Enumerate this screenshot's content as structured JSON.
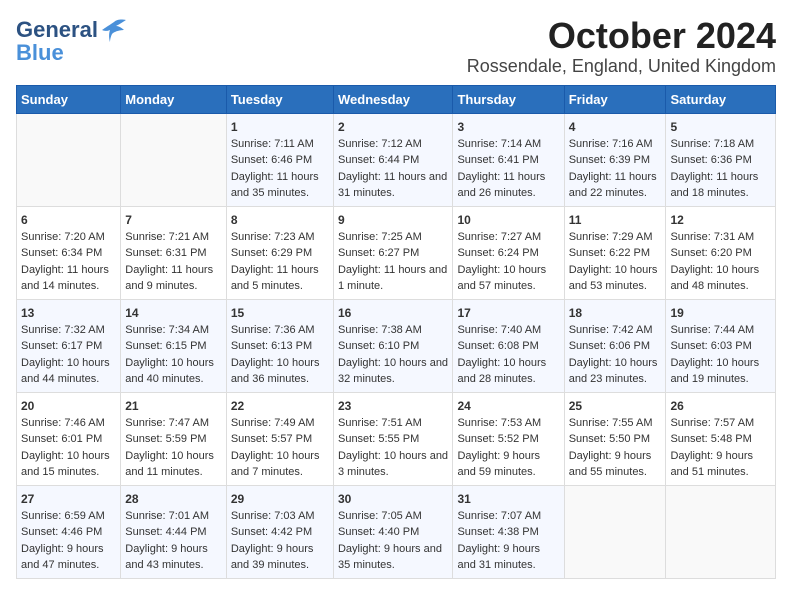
{
  "logo": {
    "line1": "General",
    "line2": "Blue"
  },
  "title": "October 2024",
  "location": "Rossendale, England, United Kingdom",
  "headers": [
    "Sunday",
    "Monday",
    "Tuesday",
    "Wednesday",
    "Thursday",
    "Friday",
    "Saturday"
  ],
  "weeks": [
    [
      {
        "day": "",
        "sunrise": "",
        "sunset": "",
        "daylight": ""
      },
      {
        "day": "",
        "sunrise": "",
        "sunset": "",
        "daylight": ""
      },
      {
        "day": "1",
        "sunrise": "Sunrise: 7:11 AM",
        "sunset": "Sunset: 6:46 PM",
        "daylight": "Daylight: 11 hours and 35 minutes."
      },
      {
        "day": "2",
        "sunrise": "Sunrise: 7:12 AM",
        "sunset": "Sunset: 6:44 PM",
        "daylight": "Daylight: 11 hours and 31 minutes."
      },
      {
        "day": "3",
        "sunrise": "Sunrise: 7:14 AM",
        "sunset": "Sunset: 6:41 PM",
        "daylight": "Daylight: 11 hours and 26 minutes."
      },
      {
        "day": "4",
        "sunrise": "Sunrise: 7:16 AM",
        "sunset": "Sunset: 6:39 PM",
        "daylight": "Daylight: 11 hours and 22 minutes."
      },
      {
        "day": "5",
        "sunrise": "Sunrise: 7:18 AM",
        "sunset": "Sunset: 6:36 PM",
        "daylight": "Daylight: 11 hours and 18 minutes."
      }
    ],
    [
      {
        "day": "6",
        "sunrise": "Sunrise: 7:20 AM",
        "sunset": "Sunset: 6:34 PM",
        "daylight": "Daylight: 11 hours and 14 minutes."
      },
      {
        "day": "7",
        "sunrise": "Sunrise: 7:21 AM",
        "sunset": "Sunset: 6:31 PM",
        "daylight": "Daylight: 11 hours and 9 minutes."
      },
      {
        "day": "8",
        "sunrise": "Sunrise: 7:23 AM",
        "sunset": "Sunset: 6:29 PM",
        "daylight": "Daylight: 11 hours and 5 minutes."
      },
      {
        "day": "9",
        "sunrise": "Sunrise: 7:25 AM",
        "sunset": "Sunset: 6:27 PM",
        "daylight": "Daylight: 11 hours and 1 minute."
      },
      {
        "day": "10",
        "sunrise": "Sunrise: 7:27 AM",
        "sunset": "Sunset: 6:24 PM",
        "daylight": "Daylight: 10 hours and 57 minutes."
      },
      {
        "day": "11",
        "sunrise": "Sunrise: 7:29 AM",
        "sunset": "Sunset: 6:22 PM",
        "daylight": "Daylight: 10 hours and 53 minutes."
      },
      {
        "day": "12",
        "sunrise": "Sunrise: 7:31 AM",
        "sunset": "Sunset: 6:20 PM",
        "daylight": "Daylight: 10 hours and 48 minutes."
      }
    ],
    [
      {
        "day": "13",
        "sunrise": "Sunrise: 7:32 AM",
        "sunset": "Sunset: 6:17 PM",
        "daylight": "Daylight: 10 hours and 44 minutes."
      },
      {
        "day": "14",
        "sunrise": "Sunrise: 7:34 AM",
        "sunset": "Sunset: 6:15 PM",
        "daylight": "Daylight: 10 hours and 40 minutes."
      },
      {
        "day": "15",
        "sunrise": "Sunrise: 7:36 AM",
        "sunset": "Sunset: 6:13 PM",
        "daylight": "Daylight: 10 hours and 36 minutes."
      },
      {
        "day": "16",
        "sunrise": "Sunrise: 7:38 AM",
        "sunset": "Sunset: 6:10 PM",
        "daylight": "Daylight: 10 hours and 32 minutes."
      },
      {
        "day": "17",
        "sunrise": "Sunrise: 7:40 AM",
        "sunset": "Sunset: 6:08 PM",
        "daylight": "Daylight: 10 hours and 28 minutes."
      },
      {
        "day": "18",
        "sunrise": "Sunrise: 7:42 AM",
        "sunset": "Sunset: 6:06 PM",
        "daylight": "Daylight: 10 hours and 23 minutes."
      },
      {
        "day": "19",
        "sunrise": "Sunrise: 7:44 AM",
        "sunset": "Sunset: 6:03 PM",
        "daylight": "Daylight: 10 hours and 19 minutes."
      }
    ],
    [
      {
        "day": "20",
        "sunrise": "Sunrise: 7:46 AM",
        "sunset": "Sunset: 6:01 PM",
        "daylight": "Daylight: 10 hours and 15 minutes."
      },
      {
        "day": "21",
        "sunrise": "Sunrise: 7:47 AM",
        "sunset": "Sunset: 5:59 PM",
        "daylight": "Daylight: 10 hours and 11 minutes."
      },
      {
        "day": "22",
        "sunrise": "Sunrise: 7:49 AM",
        "sunset": "Sunset: 5:57 PM",
        "daylight": "Daylight: 10 hours and 7 minutes."
      },
      {
        "day": "23",
        "sunrise": "Sunrise: 7:51 AM",
        "sunset": "Sunset: 5:55 PM",
        "daylight": "Daylight: 10 hours and 3 minutes."
      },
      {
        "day": "24",
        "sunrise": "Sunrise: 7:53 AM",
        "sunset": "Sunset: 5:52 PM",
        "daylight": "Daylight: 9 hours and 59 minutes."
      },
      {
        "day": "25",
        "sunrise": "Sunrise: 7:55 AM",
        "sunset": "Sunset: 5:50 PM",
        "daylight": "Daylight: 9 hours and 55 minutes."
      },
      {
        "day": "26",
        "sunrise": "Sunrise: 7:57 AM",
        "sunset": "Sunset: 5:48 PM",
        "daylight": "Daylight: 9 hours and 51 minutes."
      }
    ],
    [
      {
        "day": "27",
        "sunrise": "Sunrise: 6:59 AM",
        "sunset": "Sunset: 4:46 PM",
        "daylight": "Daylight: 9 hours and 47 minutes."
      },
      {
        "day": "28",
        "sunrise": "Sunrise: 7:01 AM",
        "sunset": "Sunset: 4:44 PM",
        "daylight": "Daylight: 9 hours and 43 minutes."
      },
      {
        "day": "29",
        "sunrise": "Sunrise: 7:03 AM",
        "sunset": "Sunset: 4:42 PM",
        "daylight": "Daylight: 9 hours and 39 minutes."
      },
      {
        "day": "30",
        "sunrise": "Sunrise: 7:05 AM",
        "sunset": "Sunset: 4:40 PM",
        "daylight": "Daylight: 9 hours and 35 minutes."
      },
      {
        "day": "31",
        "sunrise": "Sunrise: 7:07 AM",
        "sunset": "Sunset: 4:38 PM",
        "daylight": "Daylight: 9 hours and 31 minutes."
      },
      {
        "day": "",
        "sunrise": "",
        "sunset": "",
        "daylight": ""
      },
      {
        "day": "",
        "sunrise": "",
        "sunset": "",
        "daylight": ""
      }
    ]
  ]
}
